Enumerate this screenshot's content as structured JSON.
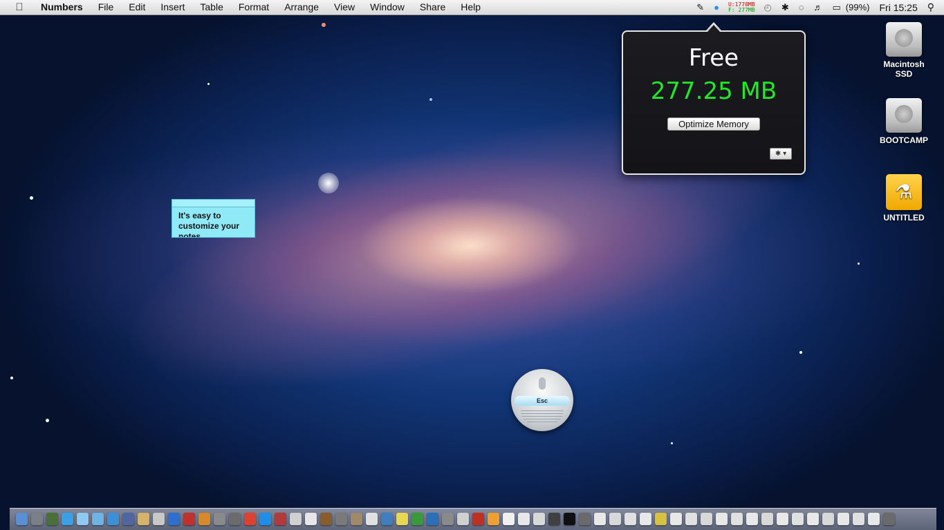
{
  "menubar": {
    "apple_icon": "apple-logo-icon",
    "app_name": "Numbers",
    "menus": [
      "File",
      "Edit",
      "Insert",
      "Table",
      "Format",
      "Arrange",
      "View",
      "Window",
      "Share",
      "Help"
    ],
    "status": {
      "memory_used": "U:1770MB",
      "memory_free": "F: 277MB",
      "battery": "(99%)",
      "clock": "Fri 15:25"
    }
  },
  "memory_popover": {
    "title": "Free",
    "value": "277.25 MB",
    "value_color": "#22e82a",
    "button_label": "Optimize Memory",
    "settings_glyph": "✱ ▾"
  },
  "desktop_icons": [
    {
      "label": "Macintosh SSD",
      "icon": "hard-drive-icon"
    },
    {
      "label": "BOOTCAMP",
      "icon": "hard-drive-icon"
    },
    {
      "label": "UNTITLED",
      "icon": "usb-drive-icon"
    }
  ],
  "sticky_note": {
    "text": "It's easy to customize your notes"
  },
  "dictation": {
    "esc_label": "Esc"
  },
  "dock": {
    "colors": [
      "#5a8fd6",
      "#7a7f88",
      "#4b6f3a",
      "#3aa0e8",
      "#8fc8f0",
      "#6db3e6",
      "#3c8fd8",
      "#5066a0",
      "#d9b26a",
      "#c8c8c8",
      "#2d6fd0",
      "#c0302c",
      "#d88a2a",
      "#8a8a8a",
      "#6b6b6b",
      "#e04030",
      "#1d8fe8",
      "#b23a3a",
      "#d0d0d0",
      "#e6e6e6",
      "#8a5c2c",
      "#7a7a7a",
      "#a08a6a",
      "#e0e0e0",
      "#3f7fbf",
      "#e8d850",
      "#3a9a3a",
      "#2a6fb8",
      "#8a8a8a",
      "#d0d0d0",
      "#c03020",
      "#f0a030",
      "#f0f0f0",
      "#e8e8e8",
      "#d8d8d8",
      "#404040",
      "#101010",
      "#6a6a6a",
      "#e8e8e8",
      "#d8d8d8",
      "#e0e0e0",
      "#e8e8e8",
      "#d8c040",
      "#e8e8e8",
      "#e0e0e0",
      "#d8d8d8",
      "#e8e8e8",
      "#e0e0e0",
      "#e8e8e8",
      "#d8d8d8",
      "#e8e8e8",
      "#e0e0e0",
      "#e8e8e8",
      "#d8d8d8",
      "#e8e8e8",
      "#e0e0e0",
      "#e8e8e8",
      "#6a6a6a"
    ]
  }
}
